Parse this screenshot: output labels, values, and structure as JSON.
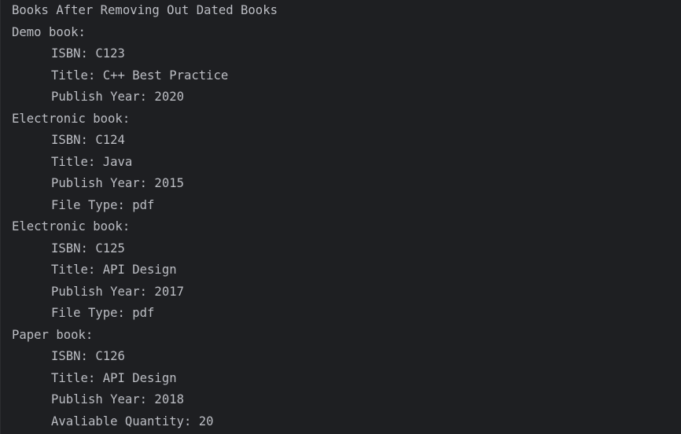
{
  "console": {
    "lines": [
      {
        "text": "Books After Removing Out Dated Books",
        "indent": false
      },
      {
        "text": "Demo book:",
        "indent": false
      },
      {
        "text": "ISBN: C123",
        "indent": true
      },
      {
        "text": "Title: C++ Best Practice",
        "indent": true
      },
      {
        "text": "Publish Year: 2020",
        "indent": true
      },
      {
        "text": "Electronic book:",
        "indent": false
      },
      {
        "text": "ISBN: C124",
        "indent": true
      },
      {
        "text": "Title: Java",
        "indent": true
      },
      {
        "text": "Publish Year: 2015",
        "indent": true
      },
      {
        "text": "File Type: pdf",
        "indent": true
      },
      {
        "text": "Electronic book:",
        "indent": false
      },
      {
        "text": "ISBN: C125",
        "indent": true
      },
      {
        "text": "Title: API Design",
        "indent": true
      },
      {
        "text": "Publish Year: 2017",
        "indent": true
      },
      {
        "text": "File Type: pdf",
        "indent": true
      },
      {
        "text": "Paper book:",
        "indent": false
      },
      {
        "text": "ISBN: C126",
        "indent": true
      },
      {
        "text": "Title: API Design",
        "indent": true
      },
      {
        "text": "Publish Year: 2018",
        "indent": true
      },
      {
        "text": "Avaliable Quantity: 20",
        "indent": true
      }
    ]
  },
  "colors": {
    "background": "#1e1f22",
    "text": "#bcbec4"
  }
}
